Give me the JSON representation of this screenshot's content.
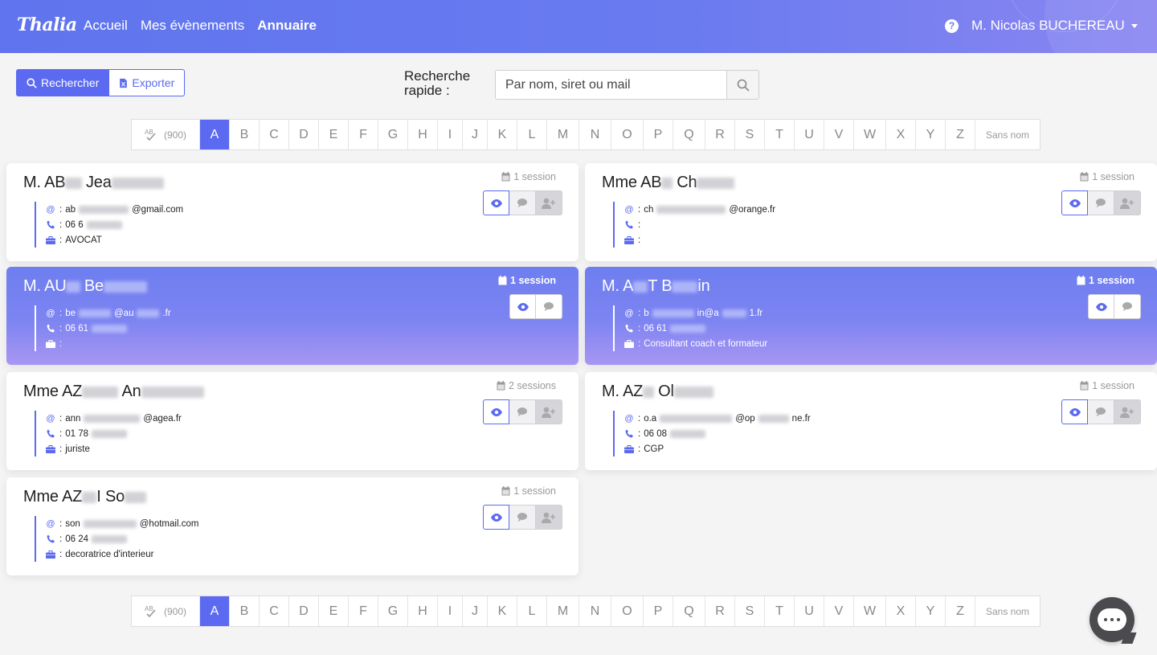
{
  "header": {
    "logo": "Thalia",
    "nav": [
      {
        "label": "Accueil",
        "active": false
      },
      {
        "label": "Mes évènements",
        "active": false
      },
      {
        "label": "Annuaire",
        "active": true
      }
    ],
    "help": "?",
    "user": "M. Nicolas BUCHEREAU"
  },
  "toolbar": {
    "search_label": "Rechercher",
    "export_label": "Exporter",
    "quick_search_label": "Recherche\nrapide :",
    "quick_search_placeholder": "Par nom, siret ou mail"
  },
  "alphabet": {
    "all_count": "(900)",
    "letters": [
      "A",
      "B",
      "C",
      "D",
      "E",
      "F",
      "G",
      "H",
      "I",
      "J",
      "K",
      "L",
      "M",
      "N",
      "O",
      "P",
      "Q",
      "R",
      "S",
      "T",
      "U",
      "V",
      "W",
      "X",
      "Y",
      "Z"
    ],
    "active": "A",
    "no_name": "Sans nom"
  },
  "cards": [
    {
      "name_a": "M. AB",
      "name_b": " Jea",
      "session": "1 session",
      "email_a": "ab",
      "email_b": "@gmail.com",
      "phone": "06 6",
      "job": "AVOCAT",
      "highlighted": false
    },
    {
      "name_a": "Mme AB",
      "name_b": " Ch",
      "session": "1 session",
      "email_a": "ch",
      "email_b": "@orange.fr",
      "phone": "",
      "job": "",
      "highlighted": false
    },
    {
      "name_a": "M. AU",
      "name_b": " Be",
      "session": "1 session",
      "email_a": "be",
      "email_b": "@au",
      "email_c": ".fr",
      "phone": "06 61",
      "job": "",
      "highlighted": true
    },
    {
      "name_a": "M. A",
      "name_b": "T B",
      "name_c": "in",
      "session": "1 session",
      "email_a": "b",
      "email_b": "in@a",
      "email_c": "1.fr",
      "phone": "06 61",
      "job": "Consultant coach et formateur",
      "highlighted": true
    },
    {
      "name_a": "Mme AZ",
      "name_b": " An",
      "session": "2 sessions",
      "email_a": "ann",
      "email_b": "@agea.fr",
      "phone": "01 78",
      "job": "juriste",
      "highlighted": false
    },
    {
      "name_a": "M. AZ",
      "name_b": " Ol",
      "session": "1 session",
      "email_a": "o.a",
      "email_b": "@op",
      "email_c": "ne.fr",
      "phone": "06 08",
      "job": "CGP",
      "highlighted": false
    },
    {
      "name_a": "Mme AZ",
      "name_b": "I So",
      "session": "1 session",
      "email_a": "son",
      "email_b": "@hotmail.com",
      "phone": "06 24",
      "job": "decoratrice d'interieur",
      "highlighted": false
    }
  ],
  "info_prefix": {
    "email": ":",
    "phone": ":",
    "job": ":"
  },
  "colors": {
    "accent": "#5b6af0",
    "header_start": "#5f74ee",
    "header_end": "#8a86f1"
  }
}
